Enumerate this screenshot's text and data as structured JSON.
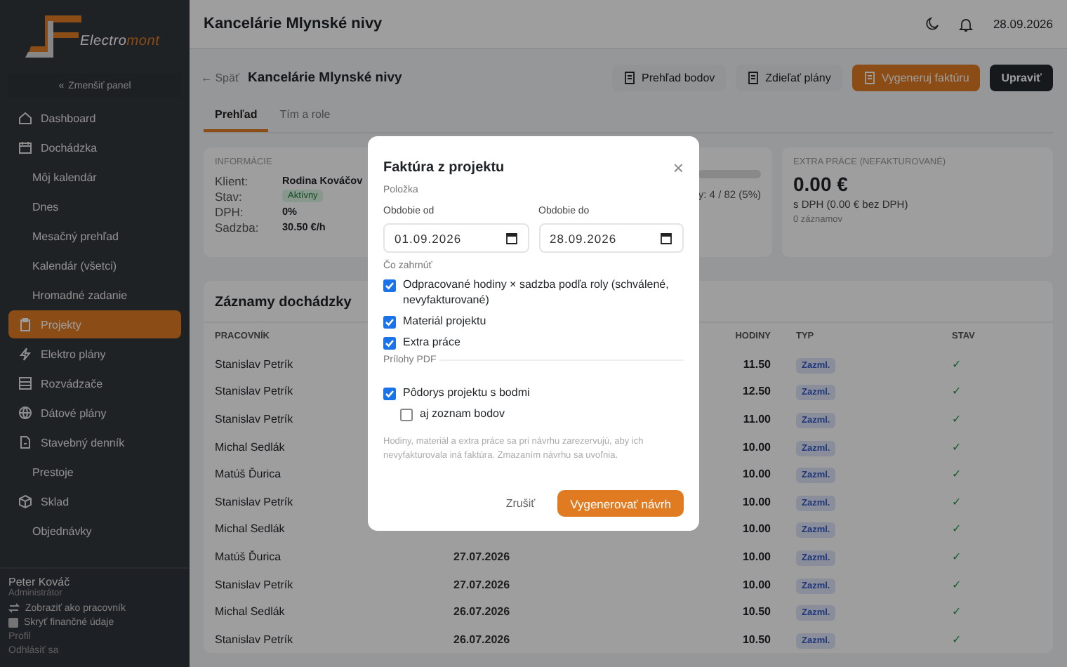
{
  "sidebar": {
    "logo": {
      "text_1": "Electro",
      "text_2": "mont"
    },
    "collapse": {
      "label": "Zmenšiť panel",
      "icon": "«"
    },
    "items": [
      {
        "label": "Dashboard",
        "kind": "main",
        "selected": false
      },
      {
        "label": "Dochádzka",
        "kind": "main",
        "selected": false
      },
      {
        "label": "Môj kalendár",
        "kind": "sub",
        "selected": false
      },
      {
        "label": "Dnes",
        "kind": "sub",
        "selected": false
      },
      {
        "label": "Mesačný prehľad",
        "kind": "sub",
        "selected": false
      },
      {
        "label": "Kalendár (všetci)",
        "kind": "sub",
        "selected": false
      },
      {
        "label": "Hromadné zadanie",
        "kind": "sub",
        "selected": false
      },
      {
        "label": "Projekty",
        "kind": "main",
        "selected": true
      },
      {
        "label": "Elektro plány",
        "kind": "main",
        "selected": false
      },
      {
        "label": "Rozvádzače",
        "kind": "main",
        "selected": false
      },
      {
        "label": "Dátové plány",
        "kind": "main",
        "selected": false
      },
      {
        "label": "Stavebný denník",
        "kind": "main",
        "selected": false
      },
      {
        "label": "Prestoje",
        "kind": "sub",
        "selected": false
      },
      {
        "label": "Sklad",
        "kind": "main",
        "selected": false
      },
      {
        "label": "Objednávky",
        "kind": "sub",
        "selected": false
      }
    ],
    "user": {
      "name": "Peter Kováč",
      "role": "Administrátor",
      "switch": "Zobraziť ako pracovník",
      "hide_finance": {
        "label": "Skryť finančné údaje",
        "checked": false
      },
      "profile": "Profil",
      "logout": "Odhlásiť sa"
    }
  },
  "header": {
    "title": "Kancelárie Mlynské nivy",
    "date": "28.09.2026"
  },
  "page": {
    "back": "← Späť",
    "title": "Kancelárie Mlynské nivy",
    "buttons": [
      {
        "label": "Prehľad bodov",
        "kind": "plain"
      },
      {
        "label": "Zdieľať plány",
        "kind": "plain"
      },
      {
        "label": "Vygeneruj faktúru",
        "kind": "primary"
      },
      {
        "label": "Upraviť",
        "kind": "dark"
      }
    ],
    "tabs": [
      {
        "label": "Prehľad",
        "selected": true
      },
      {
        "label": "Tím a role",
        "selected": false
      }
    ]
  },
  "info": {
    "heading": "INFORMÁCIE",
    "rows": [
      {
        "label": "Klient:",
        "value": "Rodina Kováčov",
        "kind": "text"
      },
      {
        "label": "Stav:",
        "value": "Aktívny",
        "kind": "badge"
      },
      {
        "label": "DPH:",
        "value": "0%",
        "kind": "text"
      },
      {
        "label": "Sadzba:",
        "value": "30.50 €/h",
        "kind": "text"
      }
    ]
  },
  "progress_card": {
    "text": "y: 4 / 82 (5%)"
  },
  "extra": {
    "heading": "EXTRA PRÁCE (NEFAKTUROVANÉ)",
    "amount": "0.00 €",
    "sub": "s DPH (0.00 € bez DPH)",
    "count": "0 záznamov"
  },
  "table": {
    "title": "Záznamy dochádzky",
    "columns": [
      "PRACOVNÍK",
      "",
      "HODINY",
      "TYP",
      "STAV"
    ],
    "rows": [
      {
        "worker": "Stanislav Petrík",
        "column_2": "",
        "hours": "11.50",
        "type": "Zazml.",
        "status": "✓"
      },
      {
        "worker": "Stanislav Petrík",
        "column_2": "",
        "hours": "12.50",
        "type": "Zazml.",
        "status": "✓"
      },
      {
        "worker": "Stanislav Petrík",
        "column_2": "",
        "hours": "11.00",
        "type": "Zazml.",
        "status": "✓"
      },
      {
        "worker": "Michal Sedlák",
        "column_2": "",
        "hours": "10.00",
        "type": "Zazml.",
        "status": "✓"
      },
      {
        "worker": "Matúš Ďurica",
        "column_2": "",
        "hours": "10.00",
        "type": "Zazml.",
        "status": "✓"
      },
      {
        "worker": "Stanislav Petrík",
        "column_2": "",
        "hours": "10.00",
        "type": "Zazml.",
        "status": "✓"
      },
      {
        "worker": "Michal Sedlák",
        "column_2": "",
        "hours": "10.00",
        "type": "Zazml.",
        "status": "✓"
      },
      {
        "worker": "Matúš Ďurica",
        "column_2": "27.07.2026",
        "hours": "10.00",
        "type": "Zazml.",
        "status": "✓"
      },
      {
        "worker": "Stanislav Petrík",
        "column_2": "27.07.2026",
        "hours": "10.00",
        "type": "Zazml.",
        "status": "✓"
      },
      {
        "worker": "Michal Sedlák",
        "column_2": "26.07.2026",
        "hours": "10.50",
        "type": "Zazml.",
        "status": "✓"
      },
      {
        "worker": "Stanislav Petrík",
        "column_2": "26.07.2026",
        "hours": "10.50",
        "type": "Zazml.",
        "status": "✓"
      }
    ]
  },
  "modal": {
    "title": "Faktúra z projektu",
    "close": "×",
    "section": "Položka",
    "fields": [
      {
        "label": "Obdobie od",
        "value": "01.09.2026"
      },
      {
        "label": "Obdobie do",
        "value": "28.09.2026"
      }
    ],
    "include_heading": "Čo zahrnúť",
    "include": [
      {
        "label": "Odpracované hodiny × sadzba podľa roly (schválené, nevyfakturované)",
        "checked": true
      },
      {
        "label": "Materiál projektu",
        "checked": true
      },
      {
        "label": "Extra práce",
        "checked": true
      }
    ],
    "attachments_heading": "Prílohy PDF",
    "attachments": [
      {
        "label": "Pôdorys projektu s bodmi",
        "checked": true,
        "kind": "main"
      },
      {
        "label": "aj zoznam bodov",
        "checked": false,
        "kind": "sub"
      }
    ],
    "note": "Hodiny, materiál a extra práce sa pri návrhu zarezervujú, aby ich nevyfakturovala iná faktúra. Zmazaním návrhu sa uvoľnia.",
    "cancel": "Zrušiť",
    "submit": "Vygenerovať návrh"
  }
}
